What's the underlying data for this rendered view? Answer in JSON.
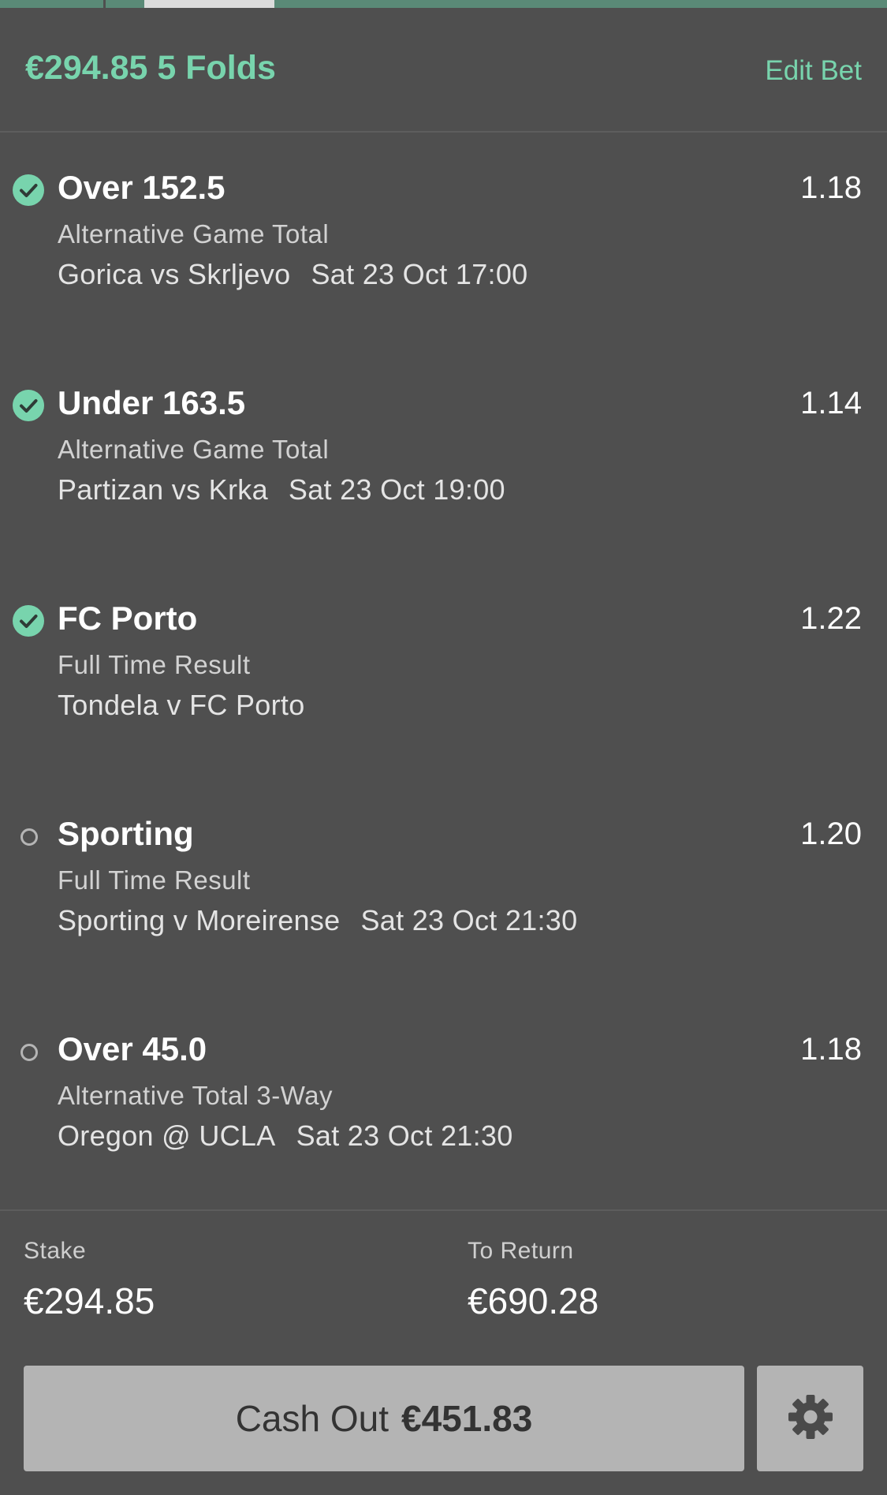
{
  "header": {
    "stake_text": "€294.85",
    "bet_type": "5 Folds",
    "edit_label": "Edit Bet"
  },
  "selections": [
    {
      "status": "won",
      "name": "Over 152.5",
      "odds": "1.18",
      "market": "Alternative Game Total",
      "event": "Gorica vs Skrljevo",
      "time": "Sat 23 Oct 17:00"
    },
    {
      "status": "won",
      "name": "Under 163.5",
      "odds": "1.14",
      "market": "Alternative Game Total",
      "event": "Partizan vs Krka",
      "time": "Sat 23 Oct 19:00"
    },
    {
      "status": "won",
      "name": "FC Porto",
      "odds": "1.22",
      "market": "Full Time Result",
      "event": "Tondela v FC Porto",
      "time": ""
    },
    {
      "status": "open",
      "name": "Sporting",
      "odds": "1.20",
      "market": "Full Time Result",
      "event": "Sporting v Moreirense",
      "time": "Sat 23 Oct 21:30"
    },
    {
      "status": "open",
      "name": "Over 45.0",
      "odds": "1.18",
      "market": "Alternative Total 3-Way",
      "event": "Oregon @ UCLA",
      "time": "Sat 23 Oct 21:30"
    }
  ],
  "summary": {
    "stake_label": "Stake",
    "stake_value": "€294.85",
    "return_label": "To Return",
    "return_value": "€690.28"
  },
  "cashout": {
    "label": "Cash Out",
    "amount": "€451.83"
  },
  "icons": {
    "won": "check-circle-icon",
    "open": "open-circle-icon",
    "settings": "gear-icon"
  },
  "colors": {
    "accent": "#78d4ad",
    "background": "#4f4f4f",
    "button": "#b4b4b4"
  }
}
